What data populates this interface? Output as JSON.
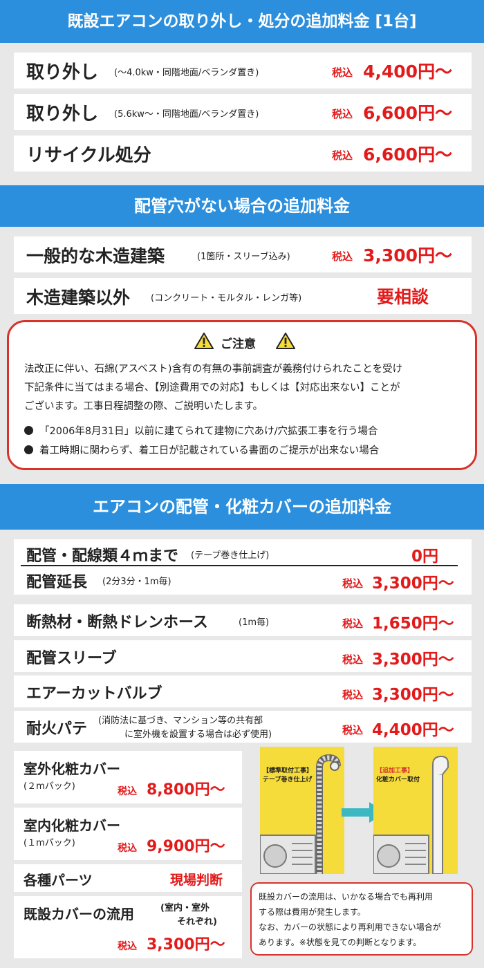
{
  "colors": {
    "header_blue": "#2b8fdd",
    "price_red": "#e21a1a",
    "notice_border": "#d7332b",
    "yellow": "#f6dc3a",
    "arrow_teal": "#3bb8c2"
  },
  "section1": {
    "title": "既設エアコンの取り外し・処分の追加料金 [1台]",
    "rows": [
      {
        "label": "取り外し",
        "sub": "(〜4.0kw・同階地面/ベランダ置き)",
        "tax": "税込",
        "price": "4,400円〜"
      },
      {
        "label": "取り外し",
        "sub": "(5.6kw〜・同階地面/ベランダ置き)",
        "tax": "税込",
        "price": "6,600円〜"
      },
      {
        "label": "リサイクル処分",
        "sub": "",
        "tax": "税込",
        "price": "6,600円〜"
      }
    ]
  },
  "section2": {
    "title": "配管穴がない場合の追加料金",
    "rows": [
      {
        "label": "一般的な木造建築",
        "sub": "(1箇所・スリーブ込み)",
        "tax": "税込",
        "price": "3,300円〜"
      },
      {
        "label": "木造建築以外",
        "sub": "(コンクリート・モルタル・レンガ等)",
        "price": "要相談"
      }
    ]
  },
  "notice": {
    "title": "ご注意",
    "lines": [
      "法改正に伴い、石綿(アスベスト)含有の有無の事前調査が義務付けられたことを受け",
      "下記条件に当てはまる場合、【別途費用での対応】もしくは【対応出来ない】ことが",
      "ございます。工事日程調整の際、ご説明いたします。"
    ],
    "bullets": [
      "「2006年8月31日」以前に建てられて建物に穴あけ/穴拡張工事を行う場合",
      "着工時期に関わらず、着工日が記載されている書面のご提示が出来ない場合"
    ]
  },
  "section3": {
    "title": "エアコンの配管・化粧カバーの追加料金",
    "row_base": {
      "label": "配管・配線類４ｍまで",
      "sub": "(テープ巻き仕上げ)",
      "price": "0円"
    },
    "row_ext": {
      "label": "配管延長",
      "sub": "(2分3分・1m毎)",
      "tax": "税込",
      "price": "3,300円〜"
    },
    "rows": [
      {
        "label": "断熱材・断熱ドレンホース",
        "sub": "(1m毎)",
        "tax": "税込",
        "price": "1,650円〜"
      },
      {
        "label": "配管スリーブ",
        "sub": "",
        "tax": "税込",
        "price": "3,300円〜"
      },
      {
        "label": "エアーカットバルブ",
        "sub": "",
        "tax": "税込",
        "price": "3,300円〜"
      },
      {
        "label": "耐火パテ",
        "sub1": "(消防法に基づき、マンション等の共有部",
        "sub2": "に室外機を設置する場合は必ず使用)",
        "tax": "税込",
        "price": "4,400円〜"
      }
    ],
    "covers": [
      {
        "label": "室外化粧カバー",
        "sub": "(２mパック)",
        "tax": "税込",
        "price": "8,800円〜"
      },
      {
        "label": "室内化粧カバー",
        "sub": "(１mパック)",
        "tax": "税込",
        "price": "9,900円〜"
      }
    ],
    "parts": {
      "label": "各種パーツ",
      "price": "現場判断"
    },
    "reuse": {
      "label": "既設カバーの流用",
      "sub1": "(室内・室外",
      "sub2": "それぞれ)",
      "tax": "税込",
      "price": "3,300円〜"
    },
    "illustration": {
      "left_tag1": "【標準取付工事】",
      "left_tag2": "テープ巻き仕上げ",
      "right_tag1": "【追加工事】",
      "right_tag2": "化粧カバー取付"
    },
    "note_lines": [
      "既設カバーの流用は、いかなる場合でも再利用",
      "する際は費用が発生します。",
      "なお、カバーの状態により再利用できない場合が",
      "あります。※状態を見ての判断となります。"
    ]
  }
}
